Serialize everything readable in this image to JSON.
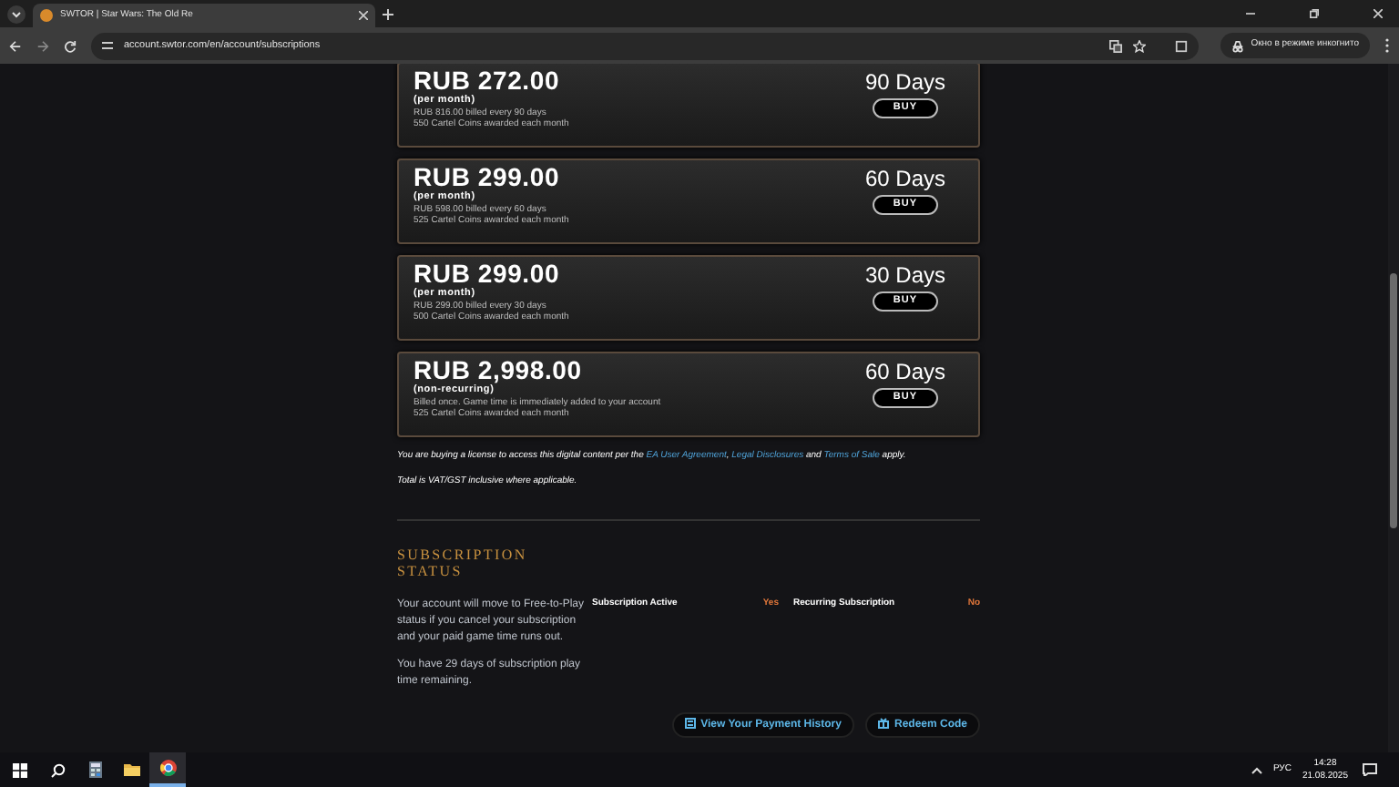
{
  "browser": {
    "tab_title": "SWTOR | Star Wars: The Old Re",
    "url": "account.swtor.com/en/account/subscriptions",
    "incognito_label": "Окно в режиме инкогнито"
  },
  "plans": [
    {
      "price": "RUB 272.00",
      "period": "(per month)",
      "details": [
        "RUB 816.00 billed every 90 days",
        "550 Cartel Coins awarded each month"
      ],
      "duration": "90 Days",
      "button": "BUY"
    },
    {
      "price": "RUB 299.00",
      "period": "(per month)",
      "details": [
        "RUB 598.00 billed every 60 days",
        "525 Cartel Coins awarded each month"
      ],
      "duration": "60 Days",
      "button": "BUY"
    },
    {
      "price": "RUB 299.00",
      "period": "(per month)",
      "details": [
        "RUB 299.00 billed every 30 days",
        "500 Cartel Coins awarded each month"
      ],
      "duration": "30 Days",
      "button": "BUY"
    },
    {
      "price": "RUB 2,998.00",
      "period": "(non-recurring)",
      "details": [
        "Billed once. Game time is immediately added to your account",
        "525 Cartel Coins awarded each month"
      ],
      "duration": "60 Days",
      "button": "BUY"
    }
  ],
  "legal": [
    {
      "kind": "text",
      "text": "You are buying a license to access this digital content per the"
    },
    {
      "kind": "link",
      "text": "EA User Agreement"
    },
    {
      "kind": "text",
      "text": ","
    },
    {
      "kind": "link",
      "text": "Legal Disclosures"
    },
    {
      "kind": "text",
      "text": "and"
    },
    {
      "kind": "link",
      "text": "Terms of Sale"
    },
    {
      "kind": "text",
      "text": "apply."
    }
  ],
  "vat_note": "Total is VAT/GST inclusive where applicable.",
  "status": {
    "title": "SUBSCRIPTION STATUS",
    "description": [
      "Your account will move to Free-to-Play status if you cancel your subscription and your paid game time runs out.",
      "You have 29 days of subscription play time remaining."
    ],
    "fields": [
      {
        "label": "Subscription Active",
        "value": "Yes"
      },
      {
        "label": "Recurring Subscription",
        "value": "No"
      }
    ],
    "buttons": [
      {
        "kind": "history",
        "label": "View Your Payment History"
      },
      {
        "kind": "redeem",
        "label": "Redeem Code"
      }
    ]
  },
  "taskbar": {
    "apps": [
      {
        "kind": "search",
        "selected": false
      },
      {
        "kind": "calculator",
        "selected": false
      },
      {
        "kind": "folder",
        "selected": false
      },
      {
        "kind": "browser",
        "selected": true
      }
    ],
    "language": "РУС",
    "time": "14:28",
    "date": "21.08.2025"
  }
}
